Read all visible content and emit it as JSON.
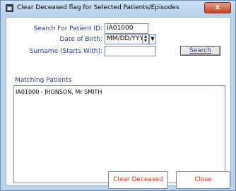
{
  "window": {
    "title": "Clear Deceased flag for Selected Patients/Episodes",
    "app_icon": "app-icon",
    "close_glyph": "x"
  },
  "form": {
    "patient_id_label": "Search For Patient ID:",
    "patient_id_value": "IA01000",
    "dob_label": "Date of Birth:",
    "dob_value": "MM/DD/YYYY",
    "surname_label": "Surname (Starts With):",
    "surname_value": "",
    "search_label": "Search"
  },
  "matching": {
    "label": "Matching Patients",
    "items": [
      "IA01000 - JHONSON, Mr SMITH"
    ]
  },
  "actions": {
    "clear_label": "Clear Deceased",
    "close_label": "Close"
  },
  "colors": {
    "label_text": "#2a3a8a",
    "button_text_red": "#c0392b",
    "window_frame": "#b8d3ec"
  }
}
